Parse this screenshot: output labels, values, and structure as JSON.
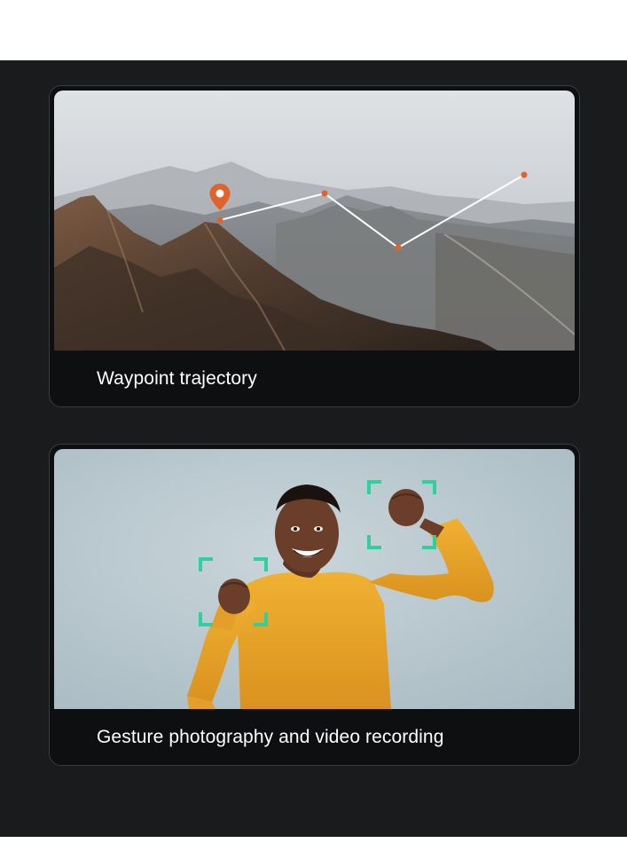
{
  "cards": [
    {
      "caption": "Waypoint trajectory",
      "image": "mountain-landscape-with-waypoint-route"
    },
    {
      "caption": "Gesture photography and video recording",
      "image": "man-raising-fists-with-gesture-detection-frames"
    }
  ],
  "colors": {
    "background": "#1a1b1c",
    "card": "#0e0f10",
    "waypoint_marker": "#e0622d",
    "gesture_frame": "#2fcf9e",
    "sweater": "#e8a52a"
  }
}
